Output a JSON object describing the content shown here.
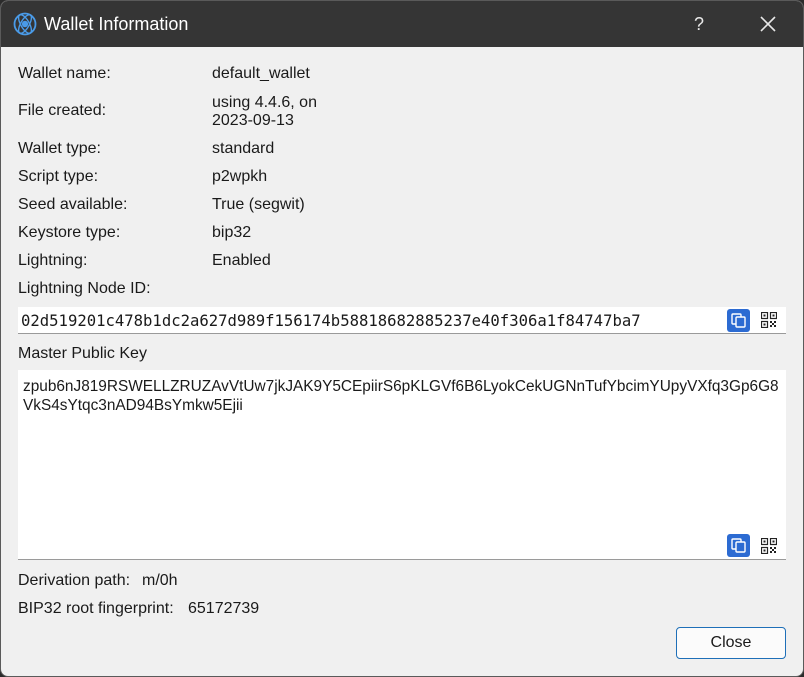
{
  "window": {
    "title": "Wallet Information",
    "help_label": "?"
  },
  "info_rows": [
    {
      "label": "Wallet name:",
      "value": "default_wallet"
    },
    {
      "label": "File created:",
      "value_line1": "using 4.4.6, on",
      "value_line2": "2023-09-13"
    },
    {
      "label": "Wallet type:",
      "value": "standard"
    },
    {
      "label": "Script type:",
      "value": "p2wpkh"
    },
    {
      "label": "Seed available:",
      "value": "True (segwit)"
    },
    {
      "label": "Keystore type:",
      "value": "bip32"
    },
    {
      "label": "Lightning:",
      "value": "Enabled"
    }
  ],
  "lightning_node": {
    "label": "Lightning Node ID:",
    "value": "02d519201c478b1dc2a627d989f156174b58818682885237e40f306a1f84747ba7"
  },
  "master_public_key": {
    "label": "Master Public Key",
    "value": "zpub6nJ819RSWELLZRUZAvVtUw7jkJAK9Y5CEpiirS6pKLGVf6B6LyokCekUGNnTufYbcimYUpyVXfq3Gp6G8VkS4sYtqc3nAD94BsYmkw5Ejii"
  },
  "derivation": {
    "label": "Derivation path:",
    "value": "m/0h"
  },
  "fingerprint": {
    "label": "BIP32 root fingerprint:",
    "value": "65172739"
  },
  "buttons": {
    "close_label": "Close"
  },
  "icons": {
    "app": "electrum-logo-icon",
    "copy": "copy-icon",
    "qr": "qr-code-icon",
    "close": "close-icon"
  },
  "colors": {
    "titlebar": "#353535",
    "accent": "#2c6bd2",
    "button_border": "#1e6fb8",
    "background": "#f0f0f0"
  }
}
